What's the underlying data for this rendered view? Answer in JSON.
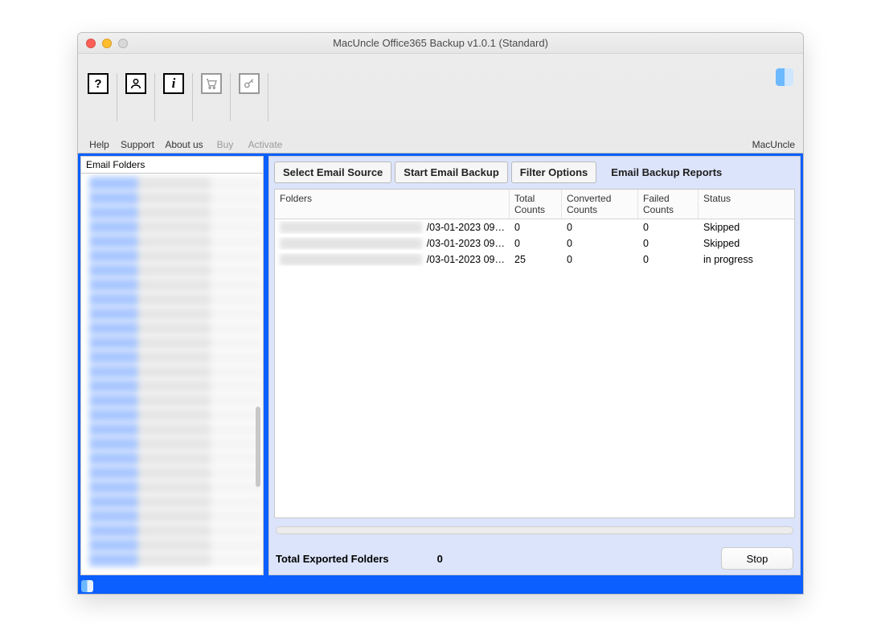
{
  "window": {
    "title": "MacUncle Office365 Backup v1.0.1 (Standard)"
  },
  "toolbar": {
    "help": {
      "label": "Help"
    },
    "support": {
      "label": "Support"
    },
    "about": {
      "label": "About us"
    },
    "buy": {
      "label": "Buy"
    },
    "activate": {
      "label": "Activate"
    },
    "brand": "MacUncle"
  },
  "sidebar": {
    "title": "Email Folders"
  },
  "tabs": {
    "source": "Select Email Source",
    "start": "Start Email Backup",
    "filter": "Filter Options",
    "reports": "Email Backup Reports"
  },
  "table": {
    "headers": {
      "folders": "Folders",
      "total": "Total Counts",
      "converted": "Converted Counts",
      "failed": "Failed Counts",
      "status": "Status"
    },
    "rows": [
      {
        "folder_suffix": "/03-01-2023 09…",
        "total": "0",
        "converted": "0",
        "failed": "0",
        "status": "Skipped"
      },
      {
        "folder_suffix": "/03-01-2023 09…",
        "total": "0",
        "converted": "0",
        "failed": "0",
        "status": "Skipped"
      },
      {
        "folder_suffix": "/03-01-2023 09…",
        "total": "25",
        "converted": "0",
        "failed": "0",
        "status": "in progress"
      }
    ]
  },
  "footer": {
    "exported_label": "Total Exported Folders",
    "exported_value": "0",
    "stop": "Stop"
  }
}
